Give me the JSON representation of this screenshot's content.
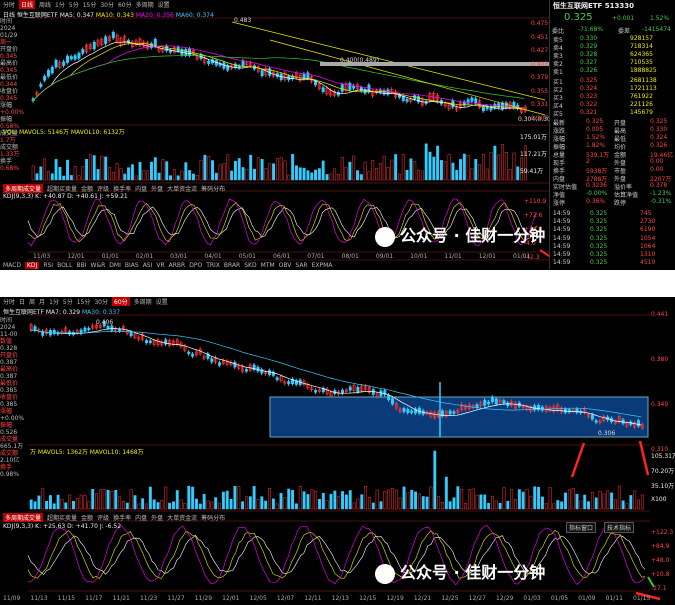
{
  "top": {
    "tabs": [
      "分时",
      "日线",
      "周线",
      "1分",
      "5分",
      "15分",
      "30分",
      "60分",
      "多周期",
      "设置"
    ],
    "security_code": "513330",
    "ma_line": {
      "label": "日线 恒生互联网ETF",
      "items": [
        "MA5: 0.347",
        "MA10: 0.343",
        "MA20: 0.356",
        "MA60: 0.374"
      ]
    },
    "info_col": [
      "时间",
      "2024",
      "01/29",
      "周一",
      "开盘价",
      "0.345",
      "最高价",
      "0.345",
      "最低价",
      "0.344",
      "收盘价",
      "0.345",
      "涨幅",
      "+0.00%",
      "振幅",
      "0.58%",
      "成交量",
      "1.7万",
      "成交额",
      "1.33万",
      "换手",
      "0.68%"
    ],
    "price_axis": [
      "0.475",
      "0.451",
      "0.427",
      "0.403",
      "0.379",
      "0.355",
      "0.331",
      "0.307"
    ],
    "annot": {
      "hi": "0.483",
      "mid": "0.400(0.489)",
      "lo": "0.304(0.304)"
    },
    "vol_line": "VOL: MAVOL5: 5146万  MAVOL10: 6132万",
    "vol_axis": [
      "175.01万",
      "117.21万",
      "59.41万"
    ],
    "bottom_tabs": [
      "多周期成交量",
      "超期买卖量",
      "金额",
      "评级",
      "换手率",
      "内盘",
      "外盘",
      "大单资金流",
      "筹码分布"
    ],
    "kdj_line": "KDJ(9,3,3) K: +40.87  D: +40.61  J: +59.21",
    "kdj_axis": [
      "+110.9",
      "+72.6",
      "+34.3",
      "-4.0",
      "-42.3"
    ],
    "ind_tabs": [
      "MACD",
      "KDJ",
      "RSI",
      "BOLL",
      "BBI",
      "W&R",
      "DMI",
      "BIAS",
      "ASI",
      "VR",
      "ARBR",
      "DPO",
      "TRIX",
      "BRAR",
      "SKD",
      "MTM",
      "OBV",
      "SAR",
      "EXPMA"
    ],
    "quote": {
      "name": "恒生互联网ETF 513330",
      "price": "0.325",
      "change": "+0.001",
      "pct": "1.52%",
      "wei_bi": "委比",
      "wb_val": "-71.68%",
      "wei_cha": "委差",
      "wc_val": "-1415474",
      "sells": [
        [
          "卖5",
          "0.330",
          "928157"
        ],
        [
          "卖4",
          "0.329",
          "718314"
        ],
        [
          "卖3",
          "0.328",
          "624365"
        ],
        [
          "卖2",
          "0.327",
          "710535"
        ],
        [
          "卖1",
          "0.326",
          "1888825"
        ]
      ],
      "buys": [
        [
          "买1",
          "0.325",
          "2681138"
        ],
        [
          "买2",
          "0.324",
          "1721113"
        ],
        [
          "买3",
          "0.323",
          "761922"
        ],
        [
          "买4",
          "0.322",
          "221126"
        ],
        [
          "买5",
          "0.321",
          "145679"
        ]
      ],
      "stats": [
        [
          "最新",
          "0.325",
          "开盘",
          "0.325"
        ],
        [
          "涨跌",
          "0.005",
          "最高",
          "0.330"
        ],
        [
          "涨幅",
          "1.52%",
          "最低",
          "0.324"
        ],
        [
          "振幅",
          "1.82%",
          "均价",
          "0.326"
        ],
        [
          "总量",
          "539.1万",
          "金额",
          "19.46亿"
        ],
        [
          "现手",
          "2",
          "外盘",
          "0.00"
        ],
        [
          "换手",
          "5938万",
          "市盈",
          "0.00"
        ],
        [
          "内盘",
          "2788万",
          "外盘",
          "2207万"
        ],
        [
          "实时估值",
          "0.3236",
          "溢价率",
          "0.378"
        ],
        [
          "净值",
          "-0.00%",
          "估算净值",
          "-1.23%"
        ],
        [
          "涨停",
          "0.36%",
          "跌停",
          "-0.31%"
        ]
      ],
      "ticks": [
        [
          "14:59",
          "0.325",
          "745"
        ],
        [
          "14:59",
          "0.325",
          "2730"
        ],
        [
          "14:59",
          "0.325",
          "6190"
        ],
        [
          "14:59",
          "0.325",
          "1054"
        ],
        [
          "14:59",
          "0.325",
          "1064"
        ],
        [
          "14:59",
          "0.325",
          "1310"
        ],
        [
          "14:59",
          "0.325",
          "4510"
        ]
      ]
    },
    "xaxis": [
      "11/03",
      "12/01",
      "01/01",
      "02/01",
      "03/01",
      "04/01",
      "05/01",
      "06/01",
      "07/01",
      "08/01",
      "09/01",
      "10/01",
      "11/01",
      "12/01",
      "01/01"
    ]
  },
  "bottom": {
    "tabs": [
      "分时",
      "日",
      "周",
      "月",
      "1分",
      "5分",
      "15分",
      "30分",
      "60分",
      "多周期",
      "设置"
    ],
    "ma_line": {
      "label": "恒生互联网ETF",
      "items": [
        "MA7: 0.329",
        "MA30: 0.337"
      ]
    },
    "info_col": [
      "时间",
      "2024",
      "11-00",
      "数值",
      "0.328",
      "开盘价",
      "0.387",
      "最高价",
      "0.387",
      "最低价",
      "0.385",
      "收盘价",
      "0.385",
      "涨幅",
      "+0.00%",
      "振幅",
      "0.526",
      "成交量",
      "665.1万",
      "成交额",
      "2.10亿",
      "换手",
      "0.98%"
    ],
    "price_axis": [
      "0.441",
      "0.380",
      "0.349",
      "0.310"
    ],
    "annot": {
      "hi": "0.406",
      "lo": "0.306"
    },
    "vol_line": "万  MAVOL5: 1362万  MAVOL10: 1468万",
    "vol_axis": [
      "105.31万",
      "70.20万",
      "35.10万",
      "X100"
    ],
    "bottom_tabs": [
      "多周期成交量",
      "超期买卖量",
      "金额",
      "评级",
      "换手率",
      "内盘",
      "外盘",
      "大单资金流",
      "筹码分布"
    ],
    "btns": [
      "指标窗口",
      "技术指标"
    ],
    "kdj_line": "KDJ(9,3,3) K: +25.63  D: +41.70  J: -6.52",
    "kdj_axis": [
      "+122.3",
      "+84.9",
      "+48.0",
      "+10.8",
      "-27.1"
    ],
    "xaxis": [
      "11/09",
      "11/13",
      "11/15",
      "11/17",
      "11/21",
      "11/23",
      "11/27",
      "11/29",
      "12/01",
      "12/05",
      "12/07",
      "12/11",
      "12/13",
      "12/15",
      "12/19",
      "12/21",
      "12/25",
      "12/27",
      "12/29",
      "01/03",
      "01/05",
      "01/09",
      "01/11",
      "01/15"
    ]
  },
  "watermark": "公众号 · 佳财一分钟"
}
